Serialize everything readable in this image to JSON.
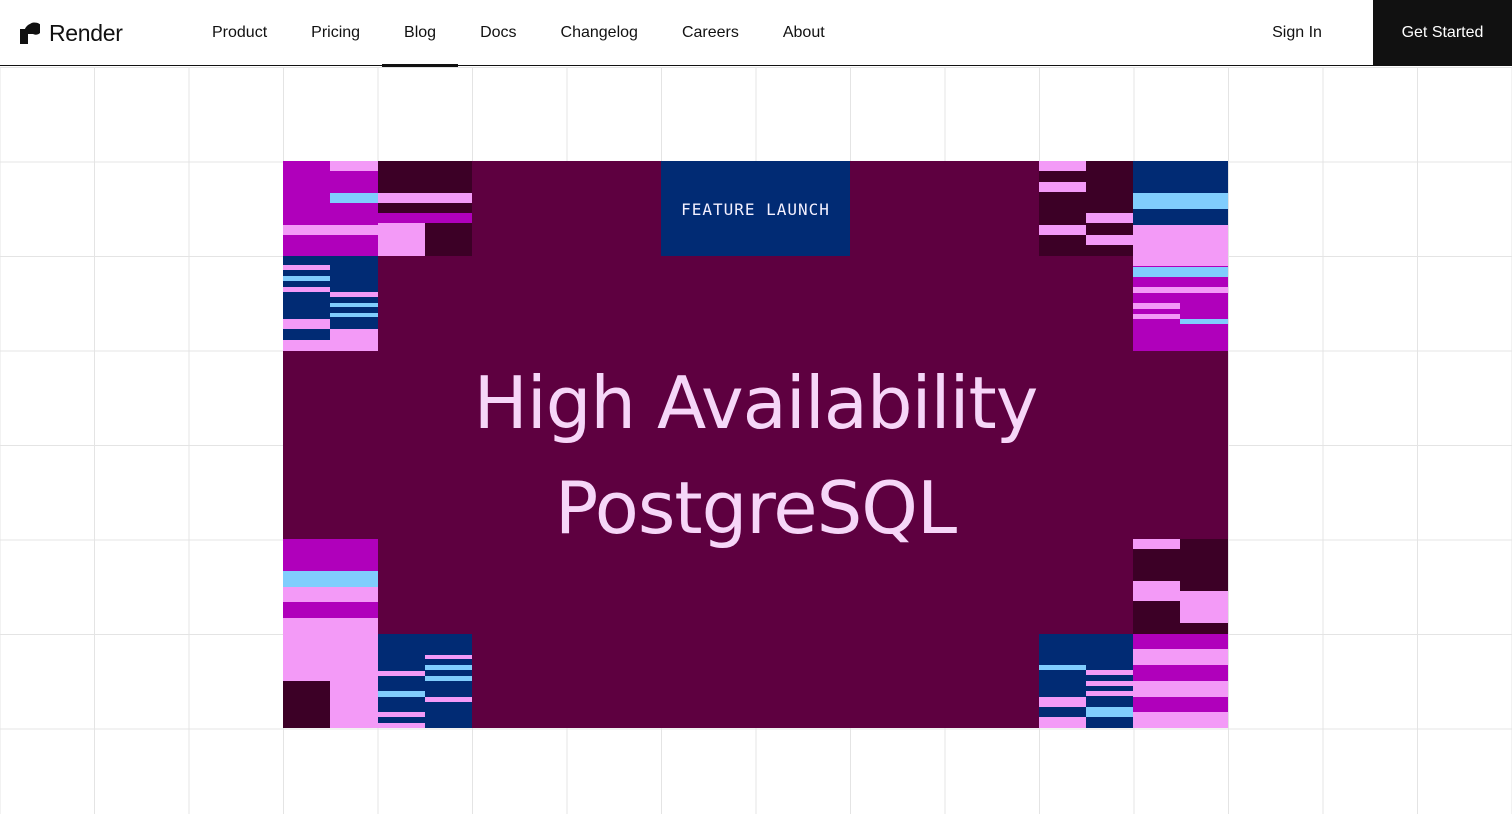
{
  "brand": {
    "name": "Render"
  },
  "nav": {
    "links": [
      {
        "label": "Product"
      },
      {
        "label": "Pricing"
      },
      {
        "label": "Blog",
        "active": true
      },
      {
        "label": "Docs"
      },
      {
        "label": "Changelog"
      },
      {
        "label": "Careers"
      },
      {
        "label": "About"
      }
    ],
    "sign_in": "Sign In",
    "get_started": "Get Started"
  },
  "hero": {
    "badge": "FEATURE LAUNCH",
    "title_line1": "High Availability",
    "title_line2": "PostgreSQL"
  },
  "colors": {
    "hero_bg": "#5e0040",
    "badge_bg": "#012b74",
    "magenta": "#b000bb",
    "pink": "#f39af7",
    "navy": "#012b74",
    "light_blue": "#80cdfd",
    "dark_plum": "#3c0026",
    "title_text": "#f6d6f8"
  }
}
